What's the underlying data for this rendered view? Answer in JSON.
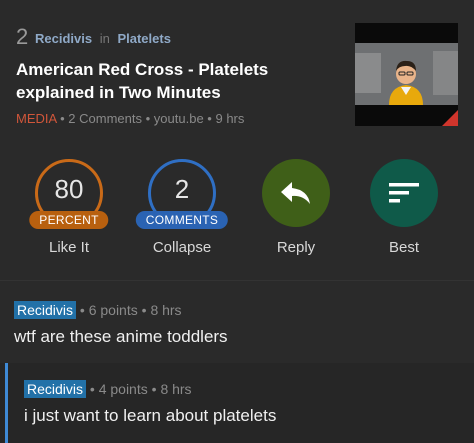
{
  "post": {
    "rank": "2",
    "author": "Recidivis",
    "in_word": "in",
    "subreddit": "Platelets",
    "title": "American Red Cross - Platelets explained in Two Minutes",
    "tag": "MEDIA",
    "comments_meta": "2 Comments",
    "domain": "youtu.be",
    "age": "9 hrs",
    "sep": "•"
  },
  "actions": {
    "percent": {
      "value": "80",
      "pill": "PERCENT",
      "label": "Like It",
      "color": "#c96a18"
    },
    "comments": {
      "value": "2",
      "pill": "COMMENTS",
      "label": "Collapse",
      "color": "#2f6fc4"
    },
    "reply": {
      "label": "Reply",
      "color": "#3f5f18",
      "icon": "reply-arrow-icon"
    },
    "best": {
      "label": "Best",
      "color": "#0f5a49",
      "icon": "sort-lines-icon"
    }
  },
  "comments": [
    {
      "author": "Recidivis",
      "points": "6 points",
      "age": "8 hrs",
      "text": "wtf are these anime toddlers"
    },
    {
      "author": "Recidivis",
      "points": "4 points",
      "age": "8 hrs",
      "text": "i just want to learn about platelets"
    }
  ]
}
